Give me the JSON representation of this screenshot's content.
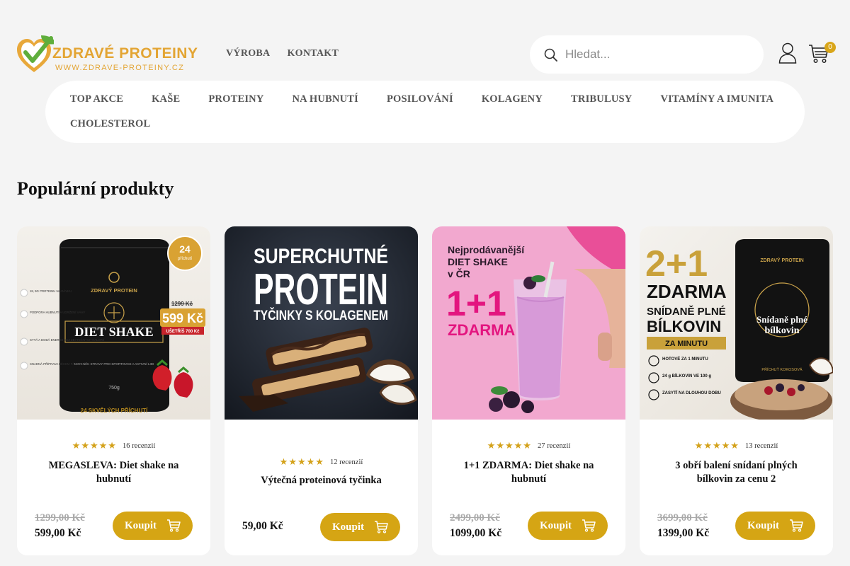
{
  "logo": {
    "part1": "ZDRAVÉ",
    "part2": "PROTEINY",
    "url": "WWW.ZDRAVE-PROTEINY.CZ"
  },
  "topnav": [
    "VÝROBA",
    "KONTAKT"
  ],
  "search": {
    "placeholder": "Hledat..."
  },
  "cart": {
    "count": "0"
  },
  "categories": [
    "TOP AKCE",
    "KAŠE",
    "PROTEINY",
    "NA HUBNUTÍ",
    "POSILOVÁNÍ",
    "KOLAGENY",
    "TRIBULUSY",
    "VITAMÍNY A IMUNITA",
    "CHOLESTEROL"
  ],
  "section_title": "Populární produkty",
  "buy_label": "Koupit",
  "products": [
    {
      "name": "MEGASLEVA: Diet shake na hubnutí",
      "rating": 5,
      "reviews": "16 recenzií",
      "old_price": "1299,00 Kč",
      "price": "599,00 Kč",
      "image": {
        "brand": "ZDRAVÝ PROTEIN",
        "product": "DIET SHAKE",
        "badge_num": "24",
        "badge_txt": "příchutí",
        "price_old": "1299 Kč",
        "price_new": "599 Kč",
        "save": "UŠETŘÍŠ 700 Kč",
        "weight": "750g",
        "footer": "24 SKVĚLÝCH PŘÍCHUTÍ",
        "bullets": [
          "18, 9G PROTEINU NA DÁVKU",
          "PODPORA HUBNUTÍ A UDRŽENÍ VÁHY",
          "SYTÁ A DODÁ ENERGII BEZ ZBYTEČNÝCH KALORIÍ",
          "SNADNÁ PŘÍPRAVA BĚHEM PÁR VTEŘIN"
        ],
        "label": "DOPLNĚK STRAVY PRO SPORTOVCE A AKTIVNÍ LIDI"
      }
    },
    {
      "name": "Výtečná proteinová tyčinka",
      "rating": 4.5,
      "reviews": "12 recenzií",
      "old_price": "",
      "price": "59,00 Kč",
      "image": {
        "l1": "SUPERCHUTNÉ",
        "l2": "PROTEIN",
        "l3": "TYČINKY S KOLAGENEM"
      }
    },
    {
      "name": "1+1 ZDARMA: Diet shake na hubnutí",
      "rating": 4.5,
      "reviews": "27 recenzií",
      "old_price": "2499,00 Kč",
      "price": "1099,00 Kč",
      "image": {
        "l1": "Nejprodávanější",
        "l2": "DIET SHAKE",
        "l3": "v ČR",
        "big": "1+1",
        "free": "ZDARMA"
      }
    },
    {
      "name": "3 obří balení snídaní plných bílkovin za cenu 2",
      "rating": 4.5,
      "reviews": "13 recenzií",
      "old_price": "3699,00 Kč",
      "price": "1399,00 Kč",
      "image": {
        "big": "2+1",
        "free": "ZDARMA",
        "l1": "SNÍDANĚ PLNÉ",
        "l2": "BÍLKOVIN",
        "strip": "ZA MINUTU",
        "brand": "ZDRAVÝ PROTEIN",
        "pkg1": "Snídaně plné",
        "pkg2": "bílkovin",
        "flavor": "PŘÍCHUŤ KOKOSOVÁ",
        "feat": [
          "HOTOVÉ ZA 1 MINUTU",
          "24 g BÍLKOVIN VE 100 g",
          "ZASYTÍ NA DLOUHOU DOBU"
        ]
      }
    }
  ],
  "colors": {
    "accent": "#d5a514",
    "logo_orange": "#e3a534",
    "logo_green": "#5fae3c",
    "star": "#d4a21b",
    "card_pink": "#f2a8cf"
  }
}
